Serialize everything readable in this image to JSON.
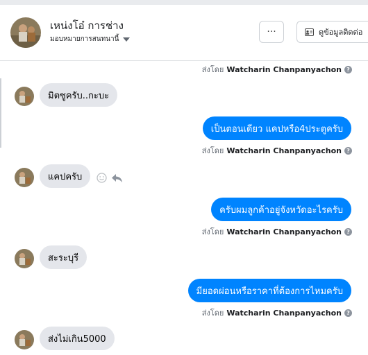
{
  "header": {
    "name": "เหน่งโอ๋ การช่าง",
    "assign_label": "มอบหมายการสนทนานี้",
    "more_label": "···",
    "contact_button": "ดูข้อมูลติดต่อ"
  },
  "sent_by": {
    "prefix": "ส่งโดย",
    "agent": "Watcharin Chanpanyachon",
    "help_icon": "?"
  },
  "messages": [
    {
      "dir": "in",
      "text": "มิตซูครับ..กะบะ"
    },
    {
      "dir": "out",
      "text": "เป็นตอนเดียว แคปหรือ4ประตูครับ"
    },
    {
      "dir": "in",
      "text": "แคปครับ"
    },
    {
      "dir": "out",
      "text": "ครับผมลูกค้าอยู่จังหวัดอะไรครับ"
    },
    {
      "dir": "in",
      "text": "สะระบุรี"
    },
    {
      "dir": "out",
      "text": "มียอดผ่อนหรือราคาที่ต้องการไหมครับ"
    },
    {
      "dir": "in",
      "text": "ส่งไม่เกิน5000"
    }
  ],
  "colors": {
    "outgoing_bubble": "#0084ff",
    "incoming_bubble": "#e4e6eb"
  }
}
